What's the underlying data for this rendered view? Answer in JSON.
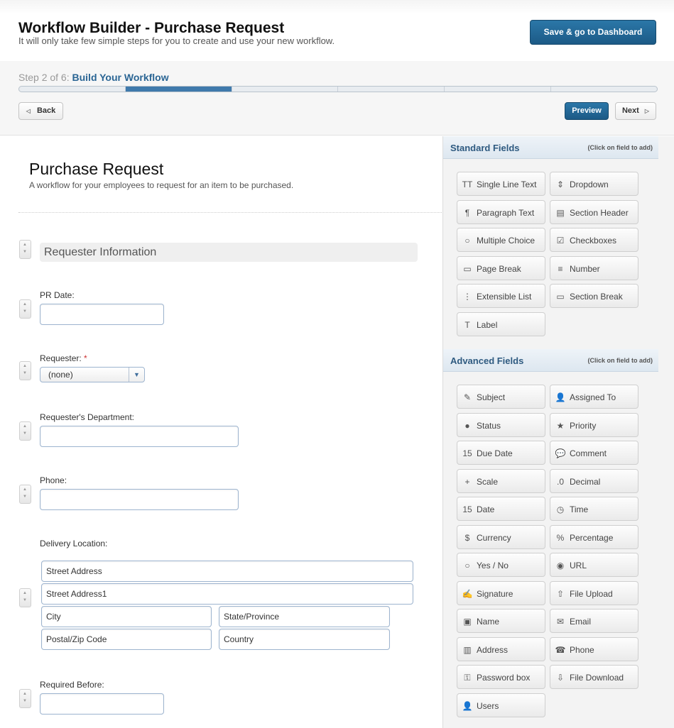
{
  "header": {
    "title": "Workflow Builder - Purchase Request",
    "subtitle": "It will only take few simple steps for you to create and use your new workflow.",
    "save_label": "Save & go to Dashboard"
  },
  "steps": {
    "step_prefix": "Step 2 of 6:",
    "step_name": "Build Your Workflow",
    "current_step": 2,
    "total_steps": 6,
    "back_label": "Back",
    "preview_label": "Preview",
    "next_label": "Next"
  },
  "form": {
    "title": "Purchase Request",
    "description": "A workflow for your employees to request for an item to be purchased.",
    "section_header": "Requester Information",
    "fields": {
      "pr_date": "PR Date:",
      "requester": "Requester:",
      "requester_required": "*",
      "requester_value": "(none)",
      "department": "Requester's Department:",
      "phone": "Phone:",
      "delivery": "Delivery Location:",
      "street": "Street Address",
      "street1": "Street Address1",
      "city": "City",
      "state": "State/Province",
      "zip": "Postal/Zip Code",
      "country": "Country",
      "required_before": "Required Before:"
    }
  },
  "panel": {
    "standard_title": "Standard Fields",
    "standard_hint": "(Click on field to add)",
    "advanced_title": "Advanced Fields",
    "advanced_hint": "(Click on field to add)",
    "standard": [
      {
        "label": "Single Line Text",
        "icon": "TT"
      },
      {
        "label": "Dropdown",
        "icon": "⇕"
      },
      {
        "label": "Paragraph Text",
        "icon": "¶"
      },
      {
        "label": "Section Header",
        "icon": "▤"
      },
      {
        "label": "Multiple Choice",
        "icon": "○"
      },
      {
        "label": "Checkboxes",
        "icon": "☑"
      },
      {
        "label": "Page Break",
        "icon": "▭"
      },
      {
        "label": "Number",
        "icon": "≡"
      },
      {
        "label": "Extensible List",
        "icon": "⋮"
      },
      {
        "label": "Section Break",
        "icon": "▭"
      },
      {
        "label": "Label",
        "icon": "T"
      }
    ],
    "advanced": [
      {
        "label": "Subject",
        "icon": "✎"
      },
      {
        "label": "Assigned To",
        "icon": "👤"
      },
      {
        "label": "Status",
        "icon": "●"
      },
      {
        "label": "Priority",
        "icon": "★"
      },
      {
        "label": "Due Date",
        "icon": "15"
      },
      {
        "label": "Comment",
        "icon": "💬"
      },
      {
        "label": "Scale",
        "icon": "+"
      },
      {
        "label": "Decimal",
        "icon": ".0"
      },
      {
        "label": "Date",
        "icon": "15"
      },
      {
        "label": "Time",
        "icon": "◷"
      },
      {
        "label": "Currency",
        "icon": "$"
      },
      {
        "label": "Percentage",
        "icon": "%"
      },
      {
        "label": "Yes / No",
        "icon": "○"
      },
      {
        "label": "URL",
        "icon": "◉"
      },
      {
        "label": "Signature",
        "icon": "✍"
      },
      {
        "label": "File Upload",
        "icon": "⇧"
      },
      {
        "label": "Name",
        "icon": "▣"
      },
      {
        "label": "Email",
        "icon": "✉"
      },
      {
        "label": "Address",
        "icon": "▥"
      },
      {
        "label": "Phone",
        "icon": "☎"
      },
      {
        "label": "Password box",
        "icon": "⚿"
      },
      {
        "label": "File Download",
        "icon": "⇩"
      },
      {
        "label": "Users",
        "icon": "👤"
      }
    ]
  }
}
